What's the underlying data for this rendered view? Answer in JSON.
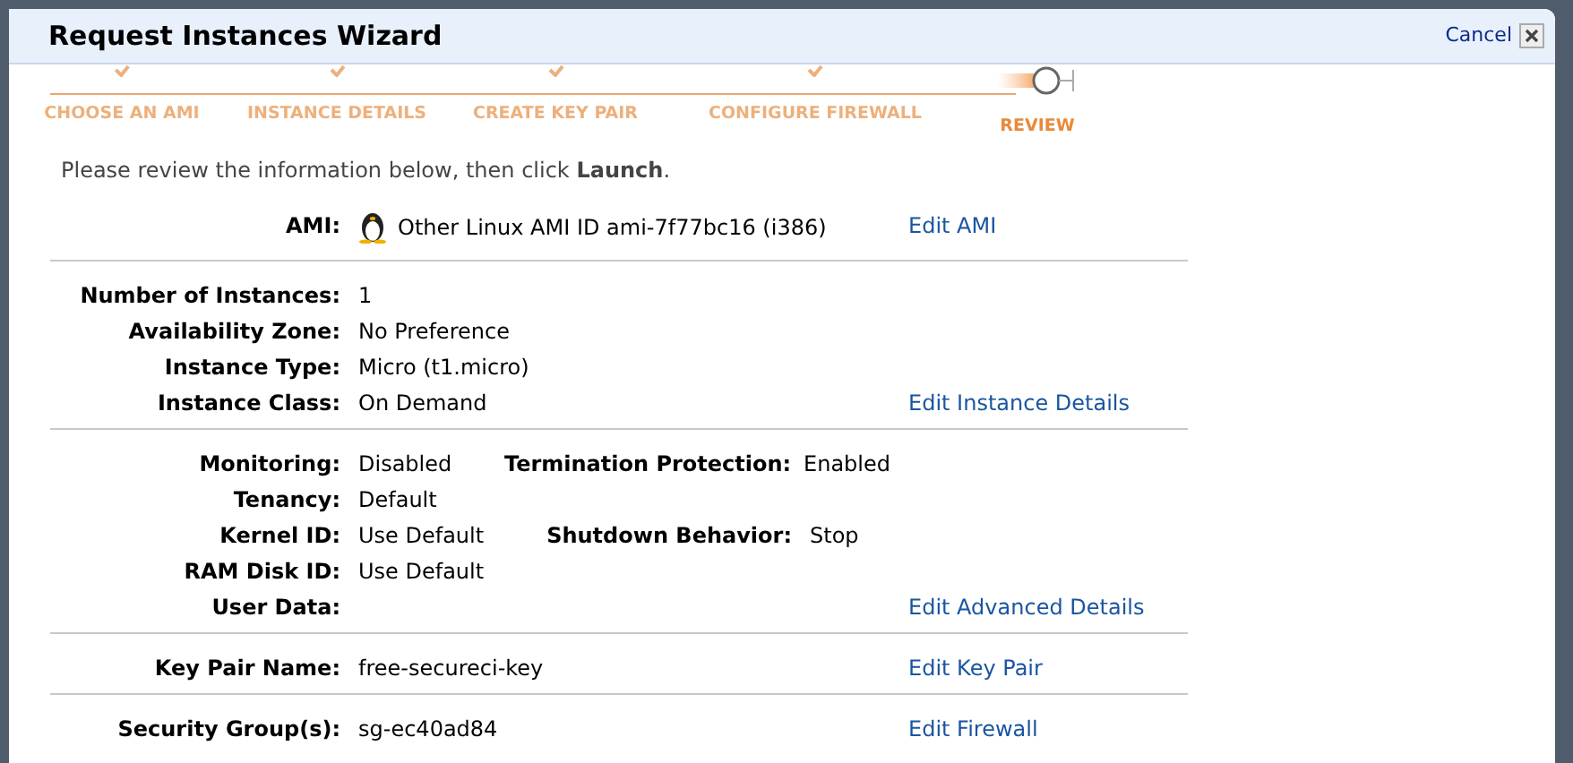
{
  "dialog": {
    "title": "Request Instances Wizard",
    "cancel": "Cancel"
  },
  "steps": [
    {
      "label": "CHOOSE AN AMI",
      "completed": true,
      "selected": false
    },
    {
      "label": "INSTANCE DETAILS",
      "completed": true,
      "selected": false
    },
    {
      "label": "CREATE KEY PAIR",
      "completed": true,
      "selected": false
    },
    {
      "label": "CONFIGURE FIREWALL",
      "completed": true,
      "selected": false
    },
    {
      "label": "REVIEW",
      "completed": false,
      "selected": true
    }
  ],
  "intro": "Please review the information below, then click **Launch**.",
  "sections": [
    {
      "rows": [
        {
          "kind": "os_image",
          "label": "AMI:",
          "value": "Other Linux AMI ID ami-7f77bc16 (i386)",
          "link": "Edit AMI"
        }
      ]
    },
    {
      "rows": [
        {
          "label": "Number of Instances:",
          "value": "1"
        },
        {
          "label": "Availability Zone:",
          "value": "No Preference"
        },
        {
          "label": "Instance Type:",
          "value": "Micro (t1.micro)"
        },
        {
          "label": "Instance Class:",
          "value": "On Demand",
          "link": "Edit Instance Details"
        }
      ]
    },
    {
      "rows": [
        {
          "label": "Monitoring:",
          "value": "Disabled",
          "label_2": "Termination Protection:",
          "value_2": "Enabled"
        },
        {
          "label": "Tenancy:",
          "value": "Default"
        },
        {
          "label": "Kernel ID:",
          "value": "Use Default",
          "label_2": "Shutdown Behavior:",
          "value_2": "Stop"
        },
        {
          "label": "RAM Disk ID:",
          "value": "Use Default"
        },
        {
          "label": "User Data:",
          "link": "Edit Advanced Details"
        }
      ]
    },
    {
      "rows": [
        {
          "label": "Key Pair Name:",
          "value": "free-secureci-key",
          "link": "Edit Key Pair"
        }
      ]
    },
    {
      "rows": [
        {
          "label": "Security Group(s):",
          "value": "sg-ec40ad84",
          "link": "Edit Firewall"
        }
      ]
    }
  ]
}
